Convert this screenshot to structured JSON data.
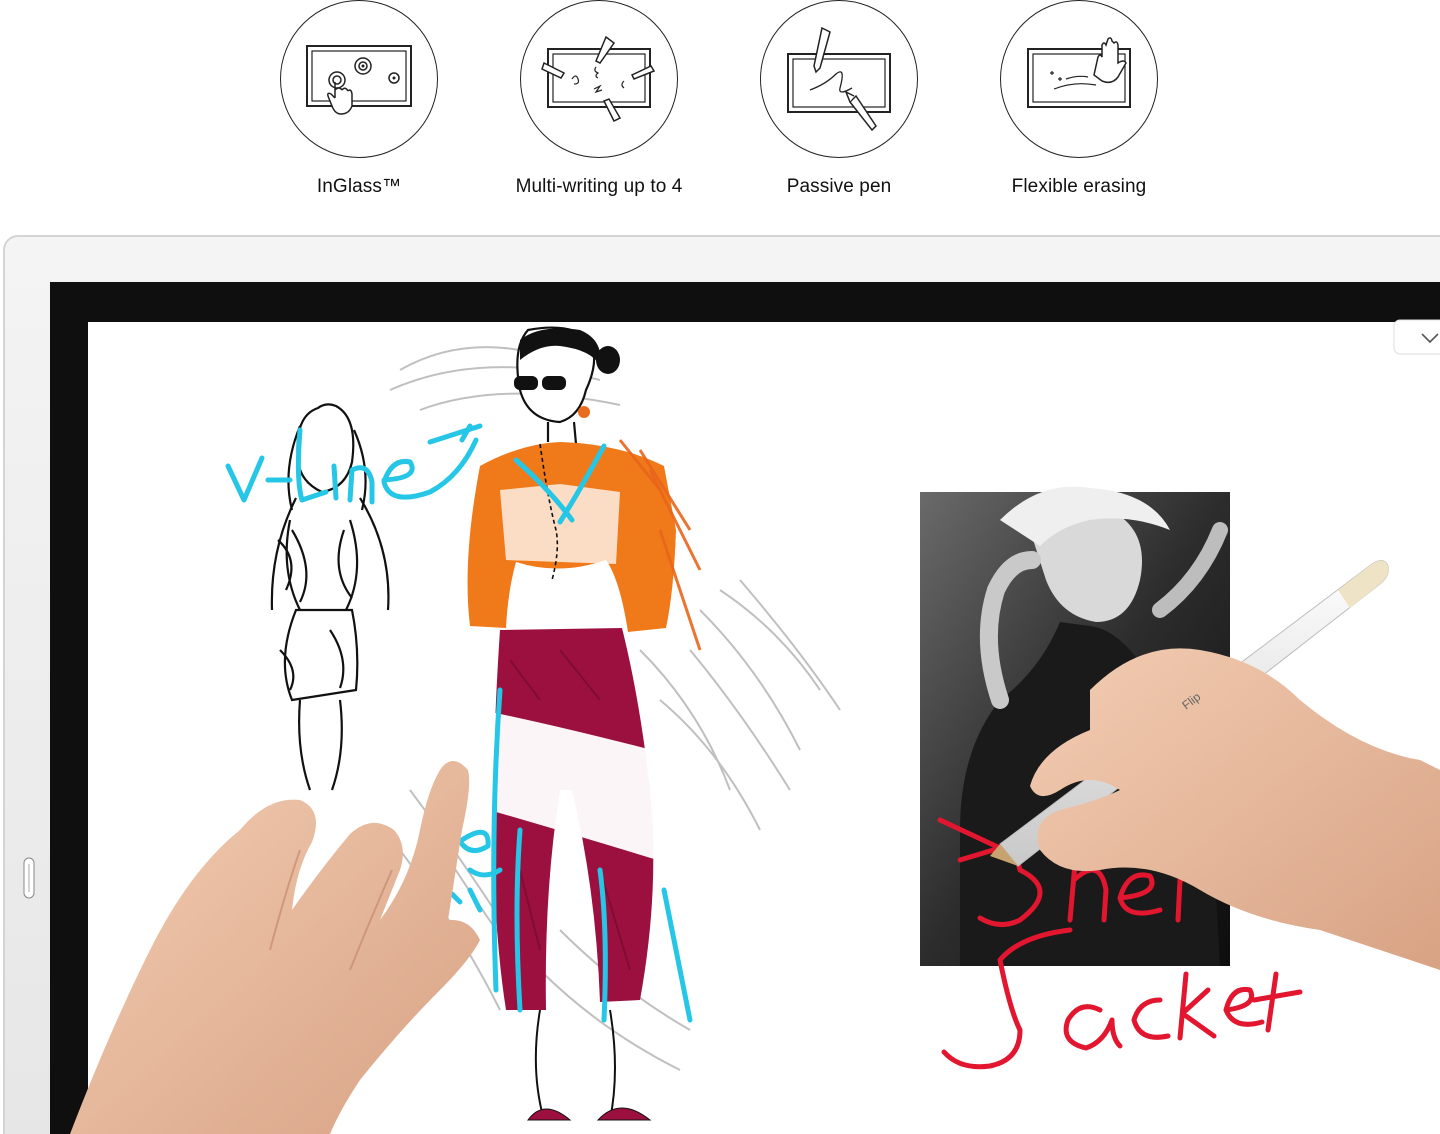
{
  "features": [
    {
      "label": "InGlass™",
      "icon": "touch-screen-icon"
    },
    {
      "label": "Multi-writing up to 4",
      "icon": "multi-pen-icon"
    },
    {
      "label": "Passive pen",
      "icon": "passive-pen-icon"
    },
    {
      "label": "Flexible erasing",
      "icon": "palm-erase-icon"
    }
  ],
  "board": {
    "handwriting": [
      "v-line",
      "Sher",
      "Jacket"
    ],
    "pen_brand": "Flip"
  },
  "colors": {
    "ink_cyan": "#26c6e6",
    "ink_red": "#e3162f",
    "paint_orange": "#f07a1a",
    "paint_crimson": "#9c1040",
    "bezel": "#111111",
    "frame": "#ececec"
  }
}
